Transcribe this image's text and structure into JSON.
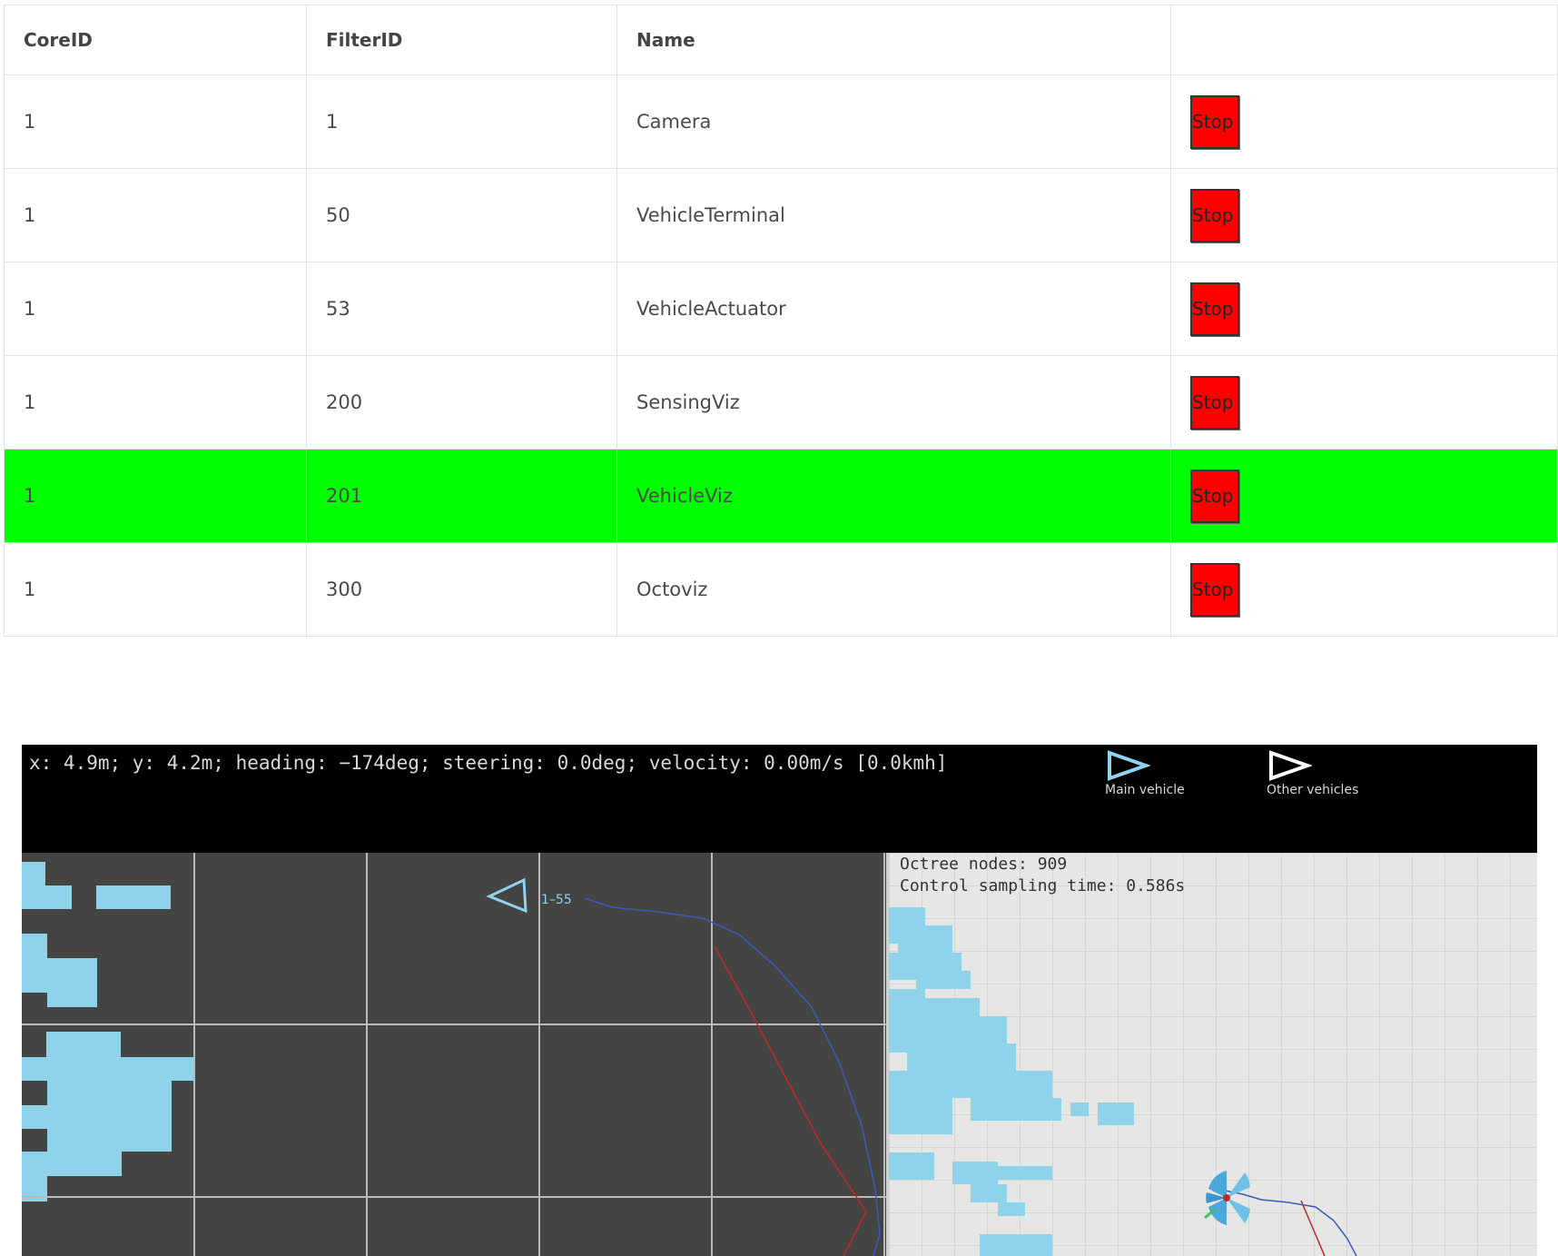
{
  "table": {
    "headers": [
      "CoreID",
      "FilterID",
      "Name",
      ""
    ],
    "rows": [
      {
        "core_id": "1",
        "filter_id": "1",
        "name": "Camera",
        "action": "Stop",
        "active": false
      },
      {
        "core_id": "1",
        "filter_id": "50",
        "name": "VehicleTerminal",
        "action": "Stop",
        "active": false
      },
      {
        "core_id": "1",
        "filter_id": "53",
        "name": "VehicleActuator",
        "action": "Stop",
        "active": false
      },
      {
        "core_id": "1",
        "filter_id": "200",
        "name": "SensingViz",
        "action": "Stop",
        "active": false
      },
      {
        "core_id": "1",
        "filter_id": "201",
        "name": "VehicleViz",
        "action": "Stop",
        "active": true
      },
      {
        "core_id": "1",
        "filter_id": "300",
        "name": "Octoviz",
        "action": "Stop",
        "active": false
      }
    ],
    "active_row_color": "#00ff00",
    "stop_button_color": "#ff0000"
  },
  "viz": {
    "status": "x: 4.9m; y: 4.2m; heading: −174deg; steering: 0.0deg; velocity: 0.00m/s [0.0kmh]",
    "legend": {
      "main_vehicle": "Main vehicle",
      "other_vehicles": "Other vehicles",
      "main_vehicle_color": "#8fd3f0",
      "other_vehicles_color": "#ffffff"
    },
    "vehicle_label": "1–55",
    "octree_nodes": "Octree nodes: 909",
    "control_sampling": "Control sampling time: 0.586s",
    "colors": {
      "obstacle": "#8fd3ea",
      "path_blue": "#3b5bbf",
      "path_red": "#c0282a",
      "left_background": "#444443",
      "right_background": "#e6e6e4"
    }
  }
}
